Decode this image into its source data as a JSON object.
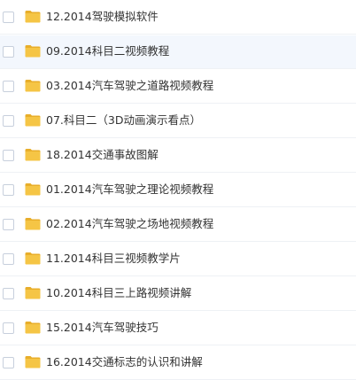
{
  "colors": {
    "folder_fill": "#f5c545",
    "folder_tab": "#e8ae2a",
    "hover_row": "#f3f7fd",
    "text": "#333333"
  },
  "file_list": {
    "items": [
      {
        "name": "12.2014驾驶模拟软件",
        "icon": "folder-icon"
      },
      {
        "name": "09.2014科目二视频教程",
        "icon": "folder-icon",
        "hover": true
      },
      {
        "name": "03.2014汽车驾驶之道路视频教程",
        "icon": "folder-icon"
      },
      {
        "name": "07.科目二（3D动画演示看点）",
        "icon": "folder-icon"
      },
      {
        "name": "18.2014交通事故图解",
        "icon": "folder-icon"
      },
      {
        "name": "01.2014汽车驾驶之理论视频教程",
        "icon": "folder-icon"
      },
      {
        "name": "02.2014汽车驾驶之场地视频教程",
        "icon": "folder-icon"
      },
      {
        "name": "11.2014科目三视频教学片",
        "icon": "folder-icon"
      },
      {
        "name": "10.2014科目三上路视频讲解",
        "icon": "folder-icon"
      },
      {
        "name": "15.2014汽车驾驶技巧",
        "icon": "folder-icon"
      },
      {
        "name": "16.2014交通标志的认识和讲解",
        "icon": "folder-icon"
      }
    ]
  }
}
